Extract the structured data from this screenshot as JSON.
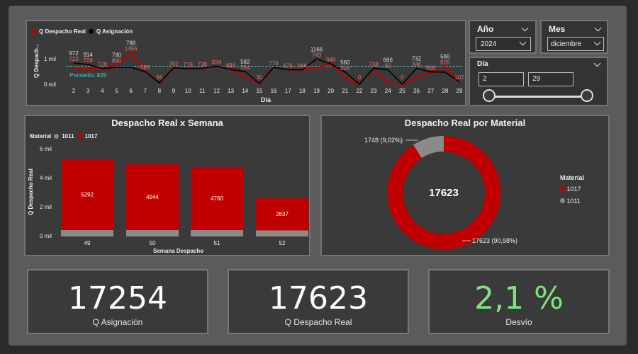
{
  "colors": {
    "real": "#c00000",
    "asignacion": "#000000",
    "other": "#8a8a8a",
    "green": "#7ee37e",
    "promedio": "#58c8c8"
  },
  "line_chart": {
    "legend": [
      "Q Despacho Real",
      "Q Asignación"
    ],
    "ylabel": "Q Despach...",
    "xlabel": "Día",
    "yticks": [
      "1 mil",
      "0 mil"
    ],
    "promedio_label": "Promedio: 829"
  },
  "slicers": {
    "anio": {
      "label": "Año",
      "value": "2024"
    },
    "mes": {
      "label": "Mes",
      "value": "diciembre"
    },
    "dia": {
      "label": "Día",
      "from": "2",
      "to": "29"
    }
  },
  "bar_title": "Despacho Real x Semana",
  "bar_legend": {
    "title": "Material",
    "items": [
      "1011",
      "1017"
    ]
  },
  "bar_axis": {
    "ylabel": "Q Despacho Real",
    "xlabel": "Semana Despacho",
    "yticks": [
      "6 mil",
      "4 mil",
      "2 mil",
      "0 mil"
    ]
  },
  "donut_title": "Despacho Real por Material",
  "donut_center": "17623",
  "donut_labels": {
    "small": "1748 (9,02%)",
    "large": "17623 (90,98%)"
  },
  "donut_legend": {
    "title": "Material",
    "items": [
      "1017",
      "1011"
    ]
  },
  "kpis": [
    {
      "value": "17254",
      "caption": "Q Asignación"
    },
    {
      "value": "17623",
      "caption": "Q Despacho Real"
    },
    {
      "value": "2,1 %",
      "caption": "Desvío"
    }
  ],
  "chart_data": [
    {
      "type": "line",
      "x": [
        2,
        3,
        4,
        5,
        6,
        7,
        8,
        9,
        10,
        11,
        12,
        13,
        14,
        15,
        16,
        17,
        18,
        19,
        20,
        21,
        22,
        23,
        24,
        25,
        26,
        27,
        28,
        29
      ],
      "series": [
        {
          "name": "Q Despacho Real",
          "values": [
            723,
            708,
            728,
            890,
            1456,
            586,
            66,
            762,
            718,
            738,
            834,
            684,
            354,
            30,
            776,
            676,
            666,
            743,
            948,
            316,
            0,
            738,
            60,
            0,
            346,
            568,
            826,
            102
          ]
        },
        {
          "name": "Q Asignación",
          "values": [
            972,
            914,
            728,
            780,
            788,
            586,
            66,
            762,
            718,
            738,
            834,
            684,
            582,
            30,
            776,
            676,
            666,
            1166,
            948,
            560,
            0,
            738,
            666,
            0,
            732,
            568,
            560,
            102
          ]
        }
      ],
      "promedio": 829,
      "ylim": [
        0,
        1600
      ],
      "xlabel": "Día",
      "ylabel": "Q Despach..."
    },
    {
      "type": "bar",
      "title": "Despacho Real x Semana",
      "categories": [
        "49",
        "50",
        "51",
        "52"
      ],
      "series": [
        {
          "name": "1011",
          "values": [
            440,
            440,
            440,
            420
          ]
        },
        {
          "name": "1017",
          "values": [
            5292,
            4944,
            4760,
            2637
          ]
        }
      ],
      "ylim": [
        0,
        6000
      ],
      "xlabel": "Semana Despacho",
      "ylabel": "Q Despacho Real"
    },
    {
      "type": "pie",
      "title": "Despacho Real por Material",
      "categories": [
        "1017",
        "1011"
      ],
      "values": [
        17623,
        1748
      ]
    }
  ]
}
